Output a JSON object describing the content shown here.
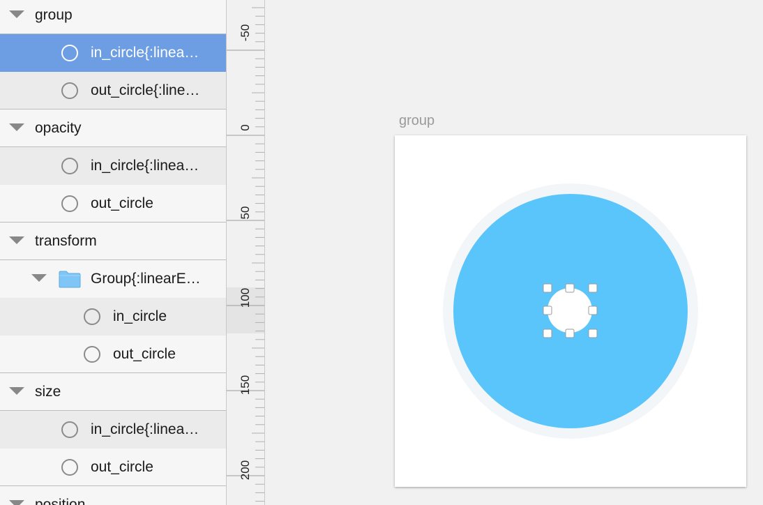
{
  "layers": {
    "rows": [
      {
        "kind": "section",
        "label": "group"
      },
      {
        "kind": "layer",
        "label": "in_circle{:linea…",
        "selected": true
      },
      {
        "kind": "layer",
        "label": "out_circle{:line…"
      },
      {
        "kind": "section",
        "label": "opacity"
      },
      {
        "kind": "layer",
        "label": "in_circle{:linea…"
      },
      {
        "kind": "layer",
        "label": "out_circle"
      },
      {
        "kind": "section",
        "label": "transform"
      },
      {
        "kind": "group",
        "label": "Group{:linearE…"
      },
      {
        "kind": "sublayer",
        "label": "in_circle"
      },
      {
        "kind": "sublayer",
        "label": "out_circle"
      },
      {
        "kind": "section",
        "label": "size"
      },
      {
        "kind": "layer",
        "label": "in_circle{:linea…"
      },
      {
        "kind": "layer",
        "label": "out_circle"
      },
      {
        "kind": "section",
        "label": "position"
      }
    ]
  },
  "ruler": {
    "labels": [
      "-50",
      "0",
      "50",
      "100",
      "150",
      "200"
    ]
  },
  "canvas": {
    "artboard_title": "group"
  },
  "colors": {
    "selection": "#6d9ee3",
    "circle_fill": "#5ac5fb",
    "halo": "#f3f6f8",
    "folder": "#7fc6f7"
  }
}
